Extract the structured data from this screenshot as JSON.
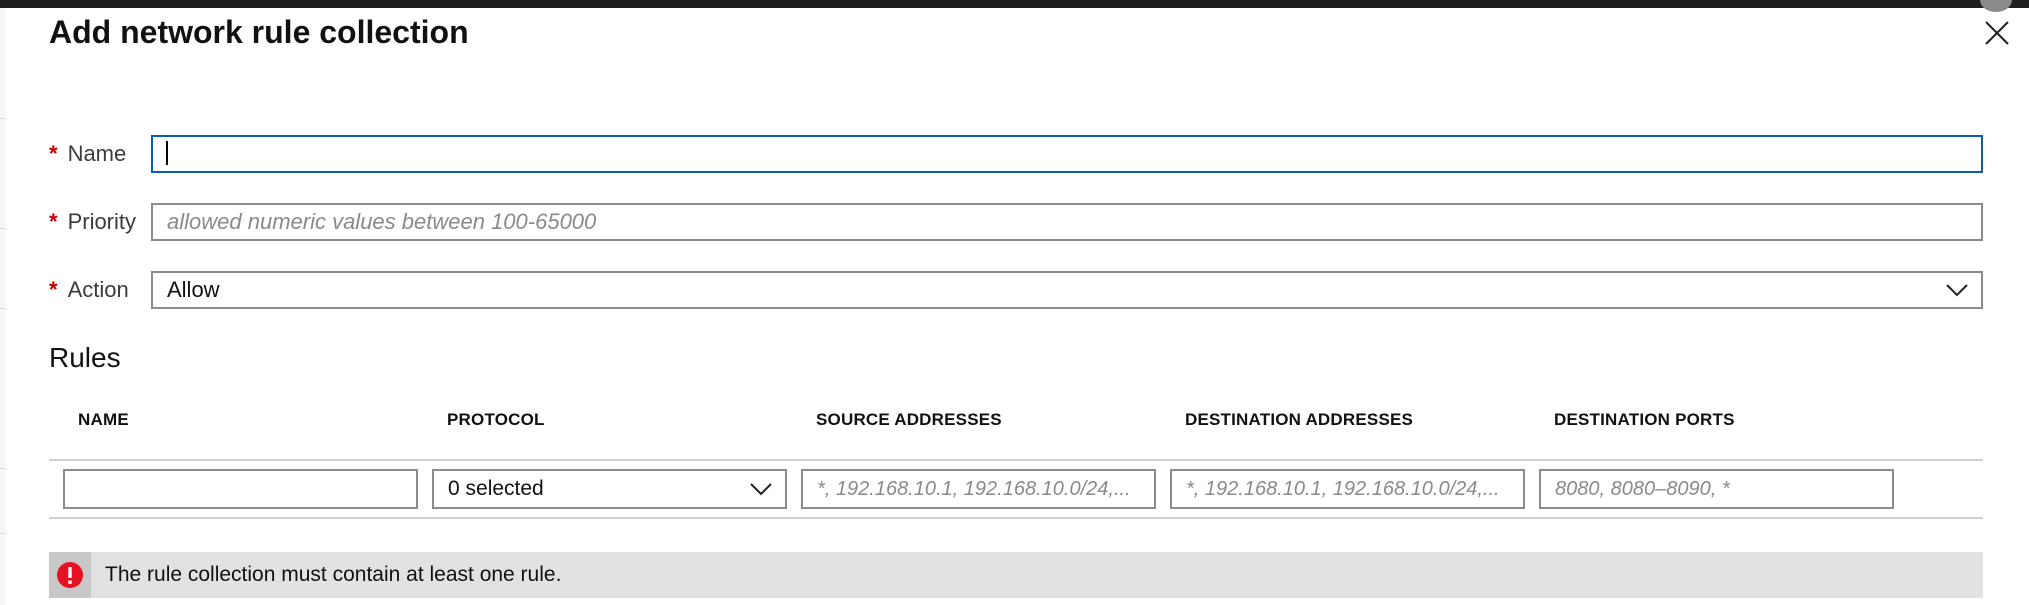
{
  "panel": {
    "title": "Add network rule collection"
  },
  "form": {
    "required_marker": "*",
    "name": {
      "label": "Name",
      "value": "",
      "placeholder": ""
    },
    "priority": {
      "label": "Priority",
      "value": "",
      "placeholder": "allowed numeric values between 100-65000"
    },
    "action": {
      "label": "Action",
      "selected": "Allow"
    }
  },
  "rules": {
    "title": "Rules",
    "columns": [
      "NAME",
      "PROTOCOL",
      "SOURCE ADDRESSES",
      "DESTINATION ADDRESSES",
      "DESTINATION PORTS"
    ],
    "row": {
      "name_value": "",
      "protocol_selected": "0 selected",
      "source_placeholder": "*, 192.168.10.1, 192.168.10.0/24,...",
      "destination_placeholder": "*, 192.168.10.1, 192.168.10.0/24,...",
      "ports_placeholder": "8080, 8080–8090, *"
    }
  },
  "alert": {
    "icon": "error-icon",
    "message": "The rule collection must contain at least one rule."
  },
  "icons": {
    "close": "close-icon",
    "dropdown": "chevron-down-icon"
  },
  "colors": {
    "focus_border": "#0b5cad",
    "required": "#c40000",
    "error": "#e81123",
    "alert_bg": "#e2e2e2"
  }
}
